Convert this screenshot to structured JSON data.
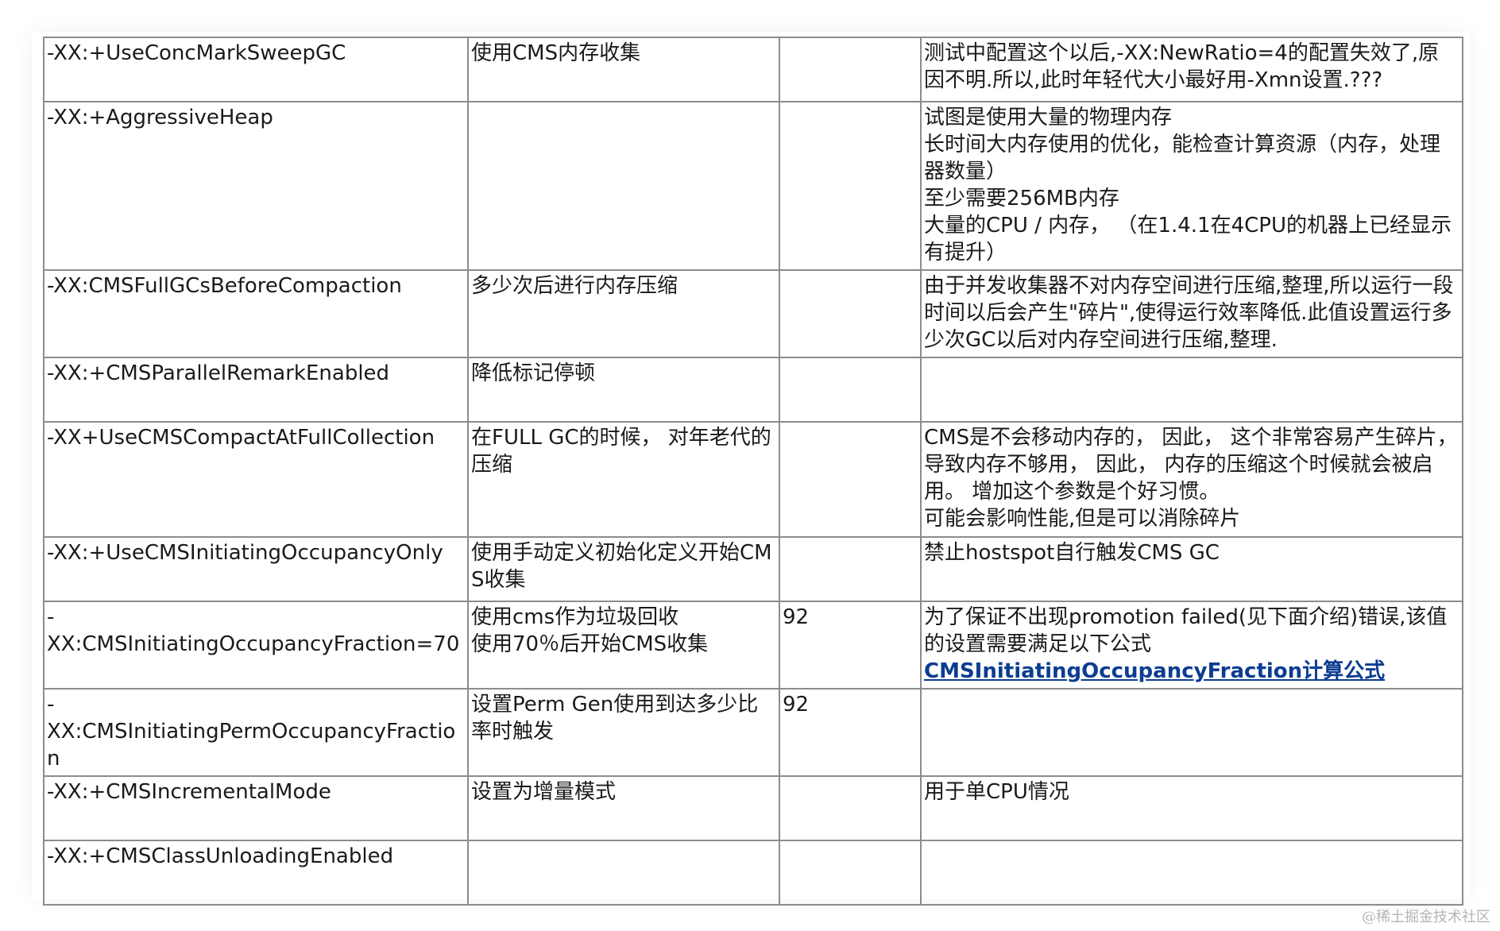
{
  "table": {
    "rows": [
      {
        "param": "-XX:+UseConcMarkSweepGC",
        "description": "使用CMS内存收集",
        "default": "",
        "note": "测试中配置这个以后,-XX:NewRatio=4的配置失效了,原因不明.所以,此时年轻代大小最好用-Xmn设置.???"
      },
      {
        "param": "-XX:+AggressiveHeap",
        "description": "",
        "default": "",
        "note": "试图是使用大量的物理内存\n长时间大内存使用的优化，能检查计算资源（内存，处理器数量）\n至少需要256MB内存\n大量的CPU / 内存， （在1.4.1在4CPU的机器上已经显示有提升）"
      },
      {
        "param": "-XX:CMSFullGCsBeforeCompaction",
        "description": "多少次后进行内存压缩",
        "default": "",
        "note": "由于并发收集器不对内存空间进行压缩,整理,所以运行一段时间以后会产生\"碎片\",使得运行效率降低.此值设置运行多少次GC以后对内存空间进行压缩,整理."
      },
      {
        "param": "-XX:+CMSParallelRemarkEnabled",
        "description": "降低标记停顿",
        "default": "",
        "note": ""
      },
      {
        "param": "-XX+UseCMSCompactAtFullCollection",
        "description": "在FULL GC的时候， 对年老代的压缩",
        "default": "",
        "note": "CMS是不会移动内存的， 因此， 这个非常容易产生碎片， 导致内存不够用， 因此， 内存的压缩这个时候就会被启用。 增加这个参数是个好习惯。\n可能会影响性能,但是可以消除碎片"
      },
      {
        "param": "-XX:+UseCMSInitiatingOccupancyOnly",
        "description": "使用手动定义初始化定义开始CMS收集",
        "default": "",
        "note": "禁止hostspot自行触发CMS GC"
      },
      {
        "param": "-\nXX:CMSInitiatingOccupancyFraction=70",
        "description": "使用cms作为垃圾回收\n使用70％后开始CMS收集",
        "default": "92",
        "note": "为了保证不出现promotion failed(见下面介绍)错误,该值的设置需要满足以下公式",
        "link": "CMSInitiatingOccupancyFraction计算公式"
      },
      {
        "param": "-\nXX:CMSInitiatingPermOccupancyFraction",
        "description": "设置Perm Gen使用到达多少比率时触发",
        "default": "92",
        "note": ""
      },
      {
        "param": "-XX:+CMSIncrementalMode",
        "description": "设置为增量模式",
        "default": "",
        "note": "用于单CPU情况"
      },
      {
        "param": "-XX:+CMSClassUnloadingEnabled",
        "description": "",
        "default": "",
        "note": ""
      }
    ]
  },
  "watermark": "@稀土掘金技术社区",
  "colors": {
    "border": "#8c8c8c",
    "text": "#1a1a1a",
    "link": "#0b3d91",
    "watermark": "#b4b4b4"
  }
}
